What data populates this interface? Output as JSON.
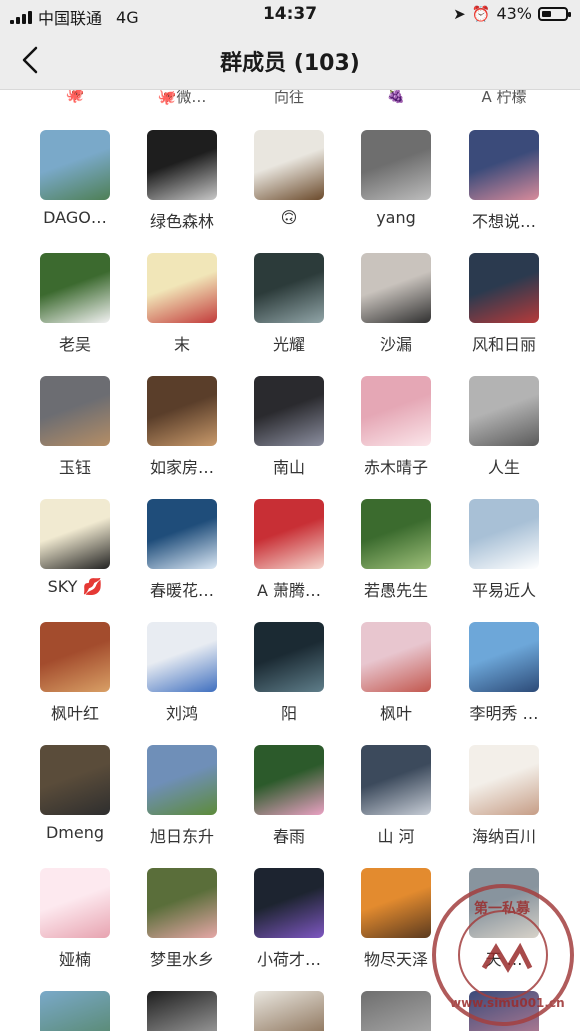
{
  "status": {
    "carrier": "中国联通",
    "network": "4G",
    "time": "14:37",
    "battery": "43%",
    "battery_level": 0.43
  },
  "nav": {
    "title": "群成员 (103)"
  },
  "partial_row": [
    {
      "name": "",
      "icon": "octopus-emoji"
    },
    {
      "name": "微…",
      "icon": "octopus-emoji"
    },
    {
      "name": "向往",
      "icon": ""
    },
    {
      "name": "",
      "icon": "grapes-emoji"
    },
    {
      "name": "A 柠檬",
      "icon": ""
    }
  ],
  "members": [
    [
      "DAGO…",
      "绿色森林",
      "🙃",
      "yang",
      "不想说…"
    ],
    [
      "老吴",
      "末",
      "光耀",
      "沙漏",
      "风和日丽"
    ],
    [
      "玉钰",
      "如家房…",
      "南山",
      "赤木晴子",
      "人生"
    ],
    [
      "SKY 💋",
      "春暖花…",
      "A  萧腾…",
      "若愚先生",
      "平易近人"
    ],
    [
      "枫叶红",
      "刘鸿",
      "阳",
      "枫叶",
      "李明秀 …"
    ],
    [
      "Dmeng",
      "旭日东升",
      "春雨",
      "山 河",
      "海纳百川"
    ],
    [
      "娅楠",
      "梦里水乡",
      "小荷才…",
      "物尽天泽",
      "天 …"
    ]
  ],
  "watermark": {
    "top_text": "第一私募",
    "bottom_text": "www.simu001.cn"
  },
  "colors": {
    "bar_bg": "#ededed",
    "text": "#1a1a1a",
    "seal": "#a33f3f"
  }
}
